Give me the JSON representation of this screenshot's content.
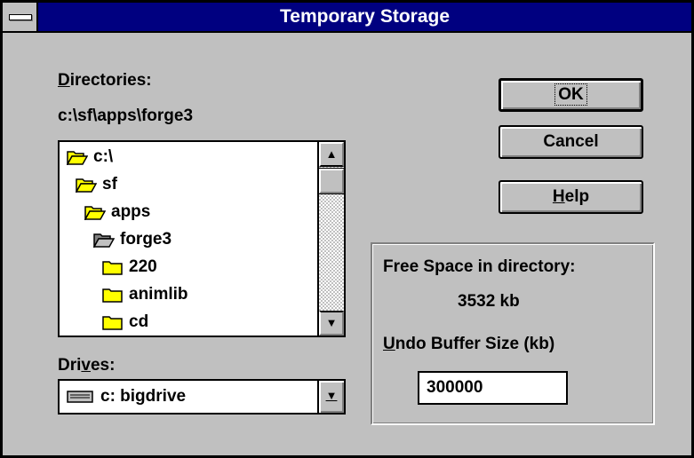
{
  "window": {
    "title": "Temporary Storage"
  },
  "directories": {
    "label_prefix": "D",
    "label_rest": "irectories:",
    "current_path": "c:\\sf\\apps\\forge3",
    "items": [
      {
        "label": "c:\\",
        "icon": "folder-open-icon"
      },
      {
        "label": "sf",
        "icon": "folder-open-icon"
      },
      {
        "label": "apps",
        "icon": "folder-open-icon"
      },
      {
        "label": "forge3",
        "icon": "folder-open-current-icon"
      },
      {
        "label": "220",
        "icon": "folder-closed-icon"
      },
      {
        "label": "animlib",
        "icon": "folder-closed-icon"
      },
      {
        "label": "cd",
        "icon": "folder-closed-icon"
      }
    ]
  },
  "drives": {
    "label_a": "Dri",
    "label_u": "v",
    "label_b": "es:",
    "selected": "c: bigdrive",
    "icon": "hard-drive-icon"
  },
  "buttons": {
    "ok": "OK",
    "cancel": "Cancel",
    "help_prefix": "H",
    "help_rest": "elp"
  },
  "space": {
    "free_label": "Free Space in directory:",
    "free_value": "3532 kb",
    "undo_prefix": "U",
    "undo_rest": "ndo Buffer Size (kb)",
    "undo_value": "300000"
  },
  "colors": {
    "titlebar": "#000080",
    "face": "#c0c0c0",
    "folder": "#ffff00"
  }
}
